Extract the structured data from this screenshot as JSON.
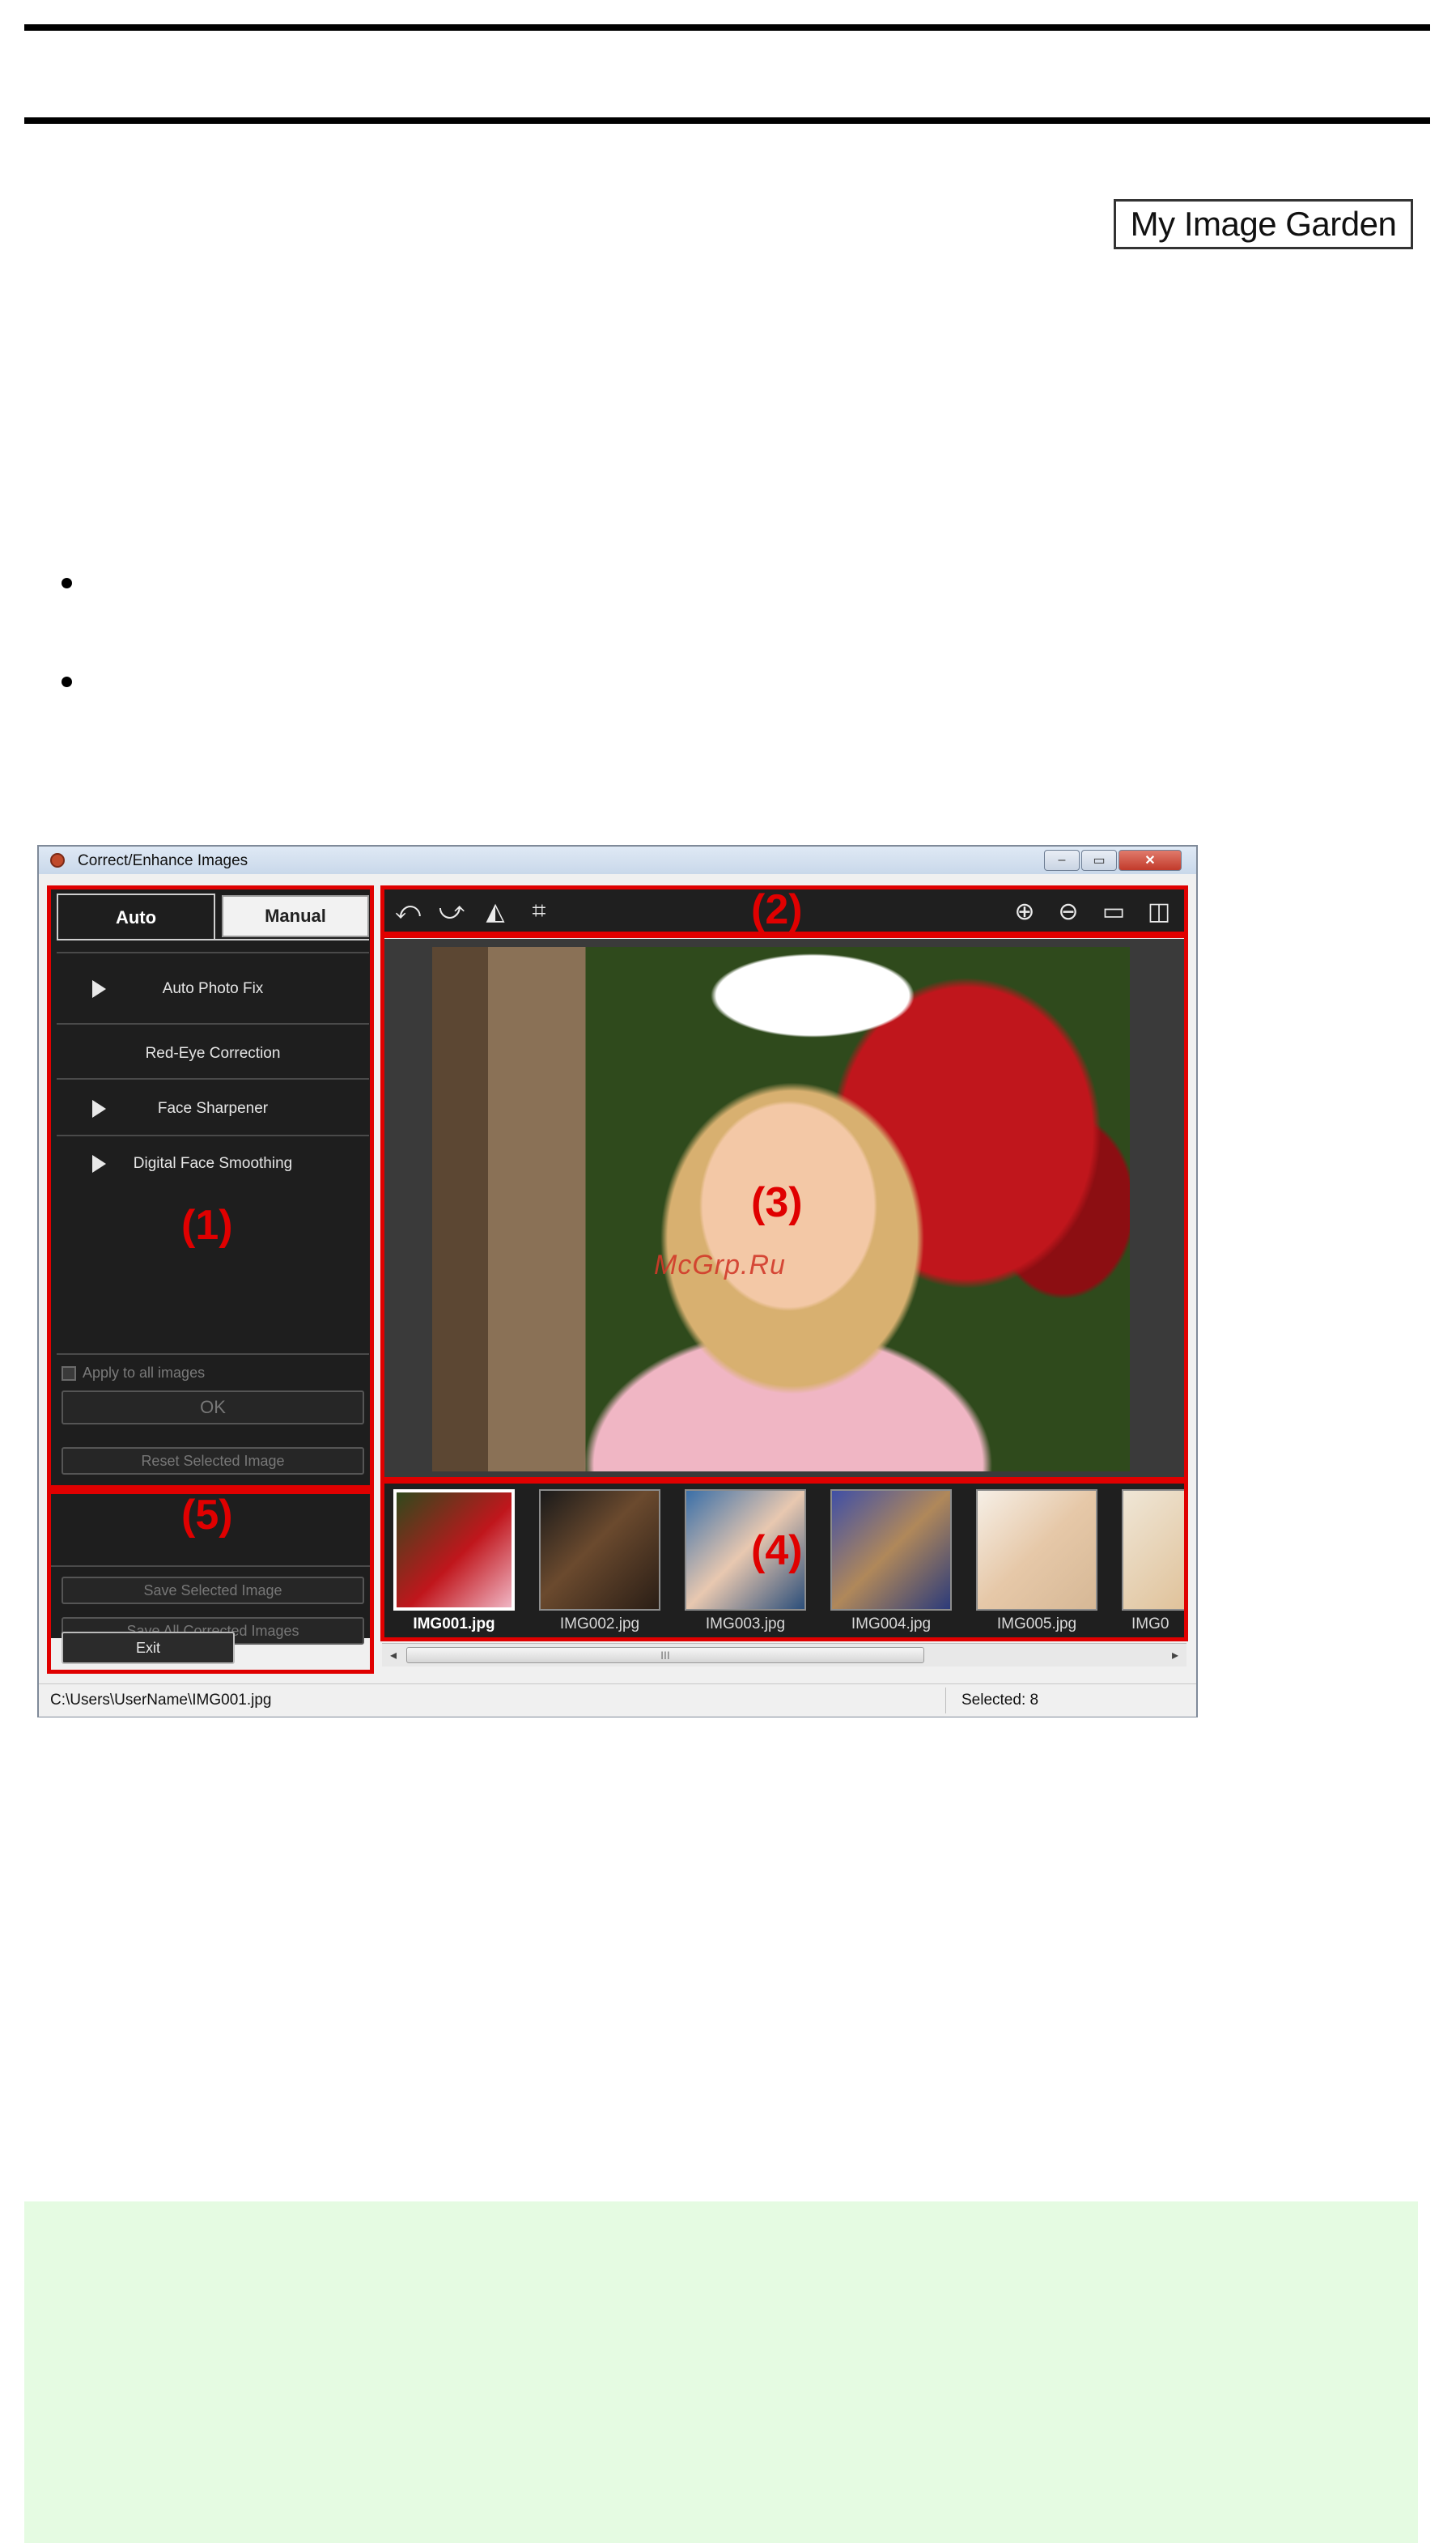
{
  "product_badge": "My Image Garden",
  "window": {
    "title": "Correct/Enhance Images",
    "controls": {
      "minimize": "–",
      "maximize": "▭",
      "close": "✕"
    }
  },
  "left_panel": {
    "tabs": [
      {
        "label": "Auto",
        "active": true
      },
      {
        "label": "Manual",
        "active": false
      }
    ],
    "functions": [
      {
        "label": "Auto Photo Fix",
        "expandable": true
      },
      {
        "label": "Red-Eye Correction",
        "expandable": false
      },
      {
        "label": "Face Sharpener",
        "expandable": true
      },
      {
        "label": "Digital Face Smoothing",
        "expandable": true
      }
    ],
    "apply_all_label": "Apply to all images",
    "ok_label": "OK",
    "reset_label": "Reset Selected Image",
    "save_selected_label": "Save Selected Image",
    "save_all_label": "Save All Corrected Images",
    "exit_label": "Exit"
  },
  "toolbar_icons": [
    "rotate-left-icon",
    "rotate-right-icon",
    "flip-horizontal-icon",
    "crop-icon",
    "zoom-in-icon",
    "zoom-out-icon",
    "full-screen-icon",
    "compare-icon"
  ],
  "thumbnails": [
    {
      "label": "IMG001.jpg",
      "selected": true
    },
    {
      "label": "IMG002.jpg",
      "selected": false
    },
    {
      "label": "IMG003.jpg",
      "selected": false
    },
    {
      "label": "IMG004.jpg",
      "selected": false
    },
    {
      "label": "IMG005.jpg",
      "selected": false
    },
    {
      "label": "IMG0",
      "selected": false
    }
  ],
  "scrollbar_grip": "III",
  "status": {
    "path": "C:\\Users\\UserName\\IMG001.jpg",
    "selected": "Selected: 8"
  },
  "callouts": [
    "(1)",
    "(2)",
    "(3)",
    "(4)",
    "(5)"
  ],
  "watermark": "McGrp.Ru",
  "colors": {
    "callout_red": "#e00000",
    "note_background": "#e5fbe2"
  }
}
